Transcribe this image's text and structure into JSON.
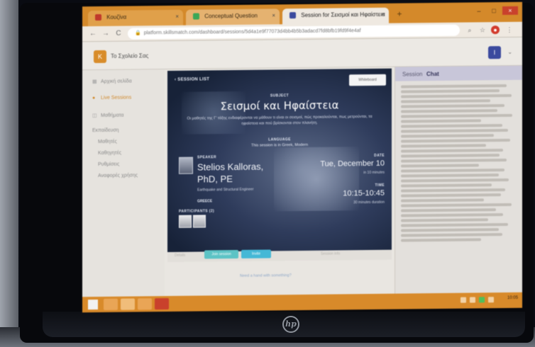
{
  "browser": {
    "tabs": [
      {
        "label": "Κουζίνα",
        "favicon_color": "#c0392b",
        "active": false
      },
      {
        "label": "Conceptual Question",
        "favicon_color": "#3aa757",
        "active": false
      },
      {
        "label": "Session for Σεισμοί και Ηφαίστεια",
        "favicon_color": "#3b4a9e",
        "active": true
      }
    ],
    "url": "platform.skillsmatch.com/dashboard/sessions/5d4a1e9f77073d4bb4b5b3adacd7fd8bfb19fd9f4e4af",
    "nav": [
      "←",
      "→",
      "C"
    ]
  },
  "app": {
    "logo_letter": "K",
    "name": "Το Σχολείο Σας",
    "avatar_letter": "Ι",
    "user_menu_symbol": "⌄"
  },
  "sidebar": {
    "items": [
      {
        "icon": "▦",
        "label": "Αρχική σελίδα",
        "active": false
      },
      {
        "icon": "●",
        "label": "Live Sessions",
        "active": true
      },
      {
        "icon": "◫",
        "label": "Μαθήματα",
        "active": false
      },
      {
        "icon": "",
        "label": "Εκπαίδευση",
        "active": false
      },
      {
        "icon": "",
        "label": "Μαθητές",
        "active": false
      },
      {
        "icon": "",
        "label": "Καθηγητές",
        "active": false
      },
      {
        "icon": "",
        "label": "Ρυθμίσεις",
        "active": false
      },
      {
        "icon": "",
        "label": "Αναφορές χρήσης",
        "active": false
      }
    ]
  },
  "session": {
    "back_label": "‹ SESSION LIST",
    "whiteboard_label": "Whiteboard",
    "subject_heading": "SUBJECT",
    "subject": "Σεισμοί και Ηφαίστεια",
    "description": "Οι μαθητές της Γ' τάξης ενδιαφέρονται να μάθουν τι είναι οι σεισμοί, πώς προκαλούνται, πως μετρούνται, τα ηφαίστεια και πού βρίσκονται στον πλανήτη.",
    "language_heading": "LANGUAGE",
    "language": "This session is in Greek, Modern",
    "speaker_heading": "SPEAKER",
    "speaker_name": "Stelios Kalloras, PhD, PE",
    "speaker_role": "Earthquake and Structural Engineer",
    "speaker_location": "GREECE",
    "date_heading": "DATE",
    "date": "Tue, December 10",
    "date_sub": "in 10 minutes",
    "time_heading": "TIME",
    "time": "10:15-10:45",
    "time_sub": "30 minutes duration",
    "participants_heading": "PARTICIPANTS (2)",
    "join_label": "Join session",
    "invite_label": "Invite",
    "footer_left": "Details",
    "footer_right": "Session info",
    "link_text": "Need a hand with something?"
  },
  "chat": {
    "tabs": [
      "Session",
      "Chat"
    ],
    "active_tab": "Chat",
    "line_count": 32
  },
  "taskbar": {
    "clock": "10:05"
  }
}
